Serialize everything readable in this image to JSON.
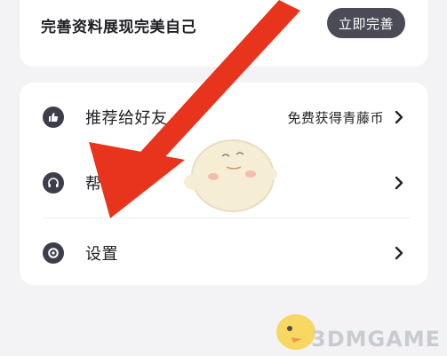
{
  "profile": {
    "prompt": "完善资料展现完美自己",
    "complete_button": "立即完善"
  },
  "menu": {
    "items": [
      {
        "label": "推荐给好友",
        "sub": "免费获得青藤币",
        "icon": "thumbs-up-icon"
      },
      {
        "label": "帮助",
        "sub": "",
        "icon": "headphones-icon"
      },
      {
        "label": "设置",
        "sub": "",
        "icon": "settings-gear-icon"
      }
    ]
  },
  "colors": {
    "background": "#f3f3f6",
    "button": "#4b4b58",
    "icon": "#3e3e4a",
    "annotation_arrow": "#e8341c"
  },
  "watermark": {
    "text": "3DMGAME"
  }
}
